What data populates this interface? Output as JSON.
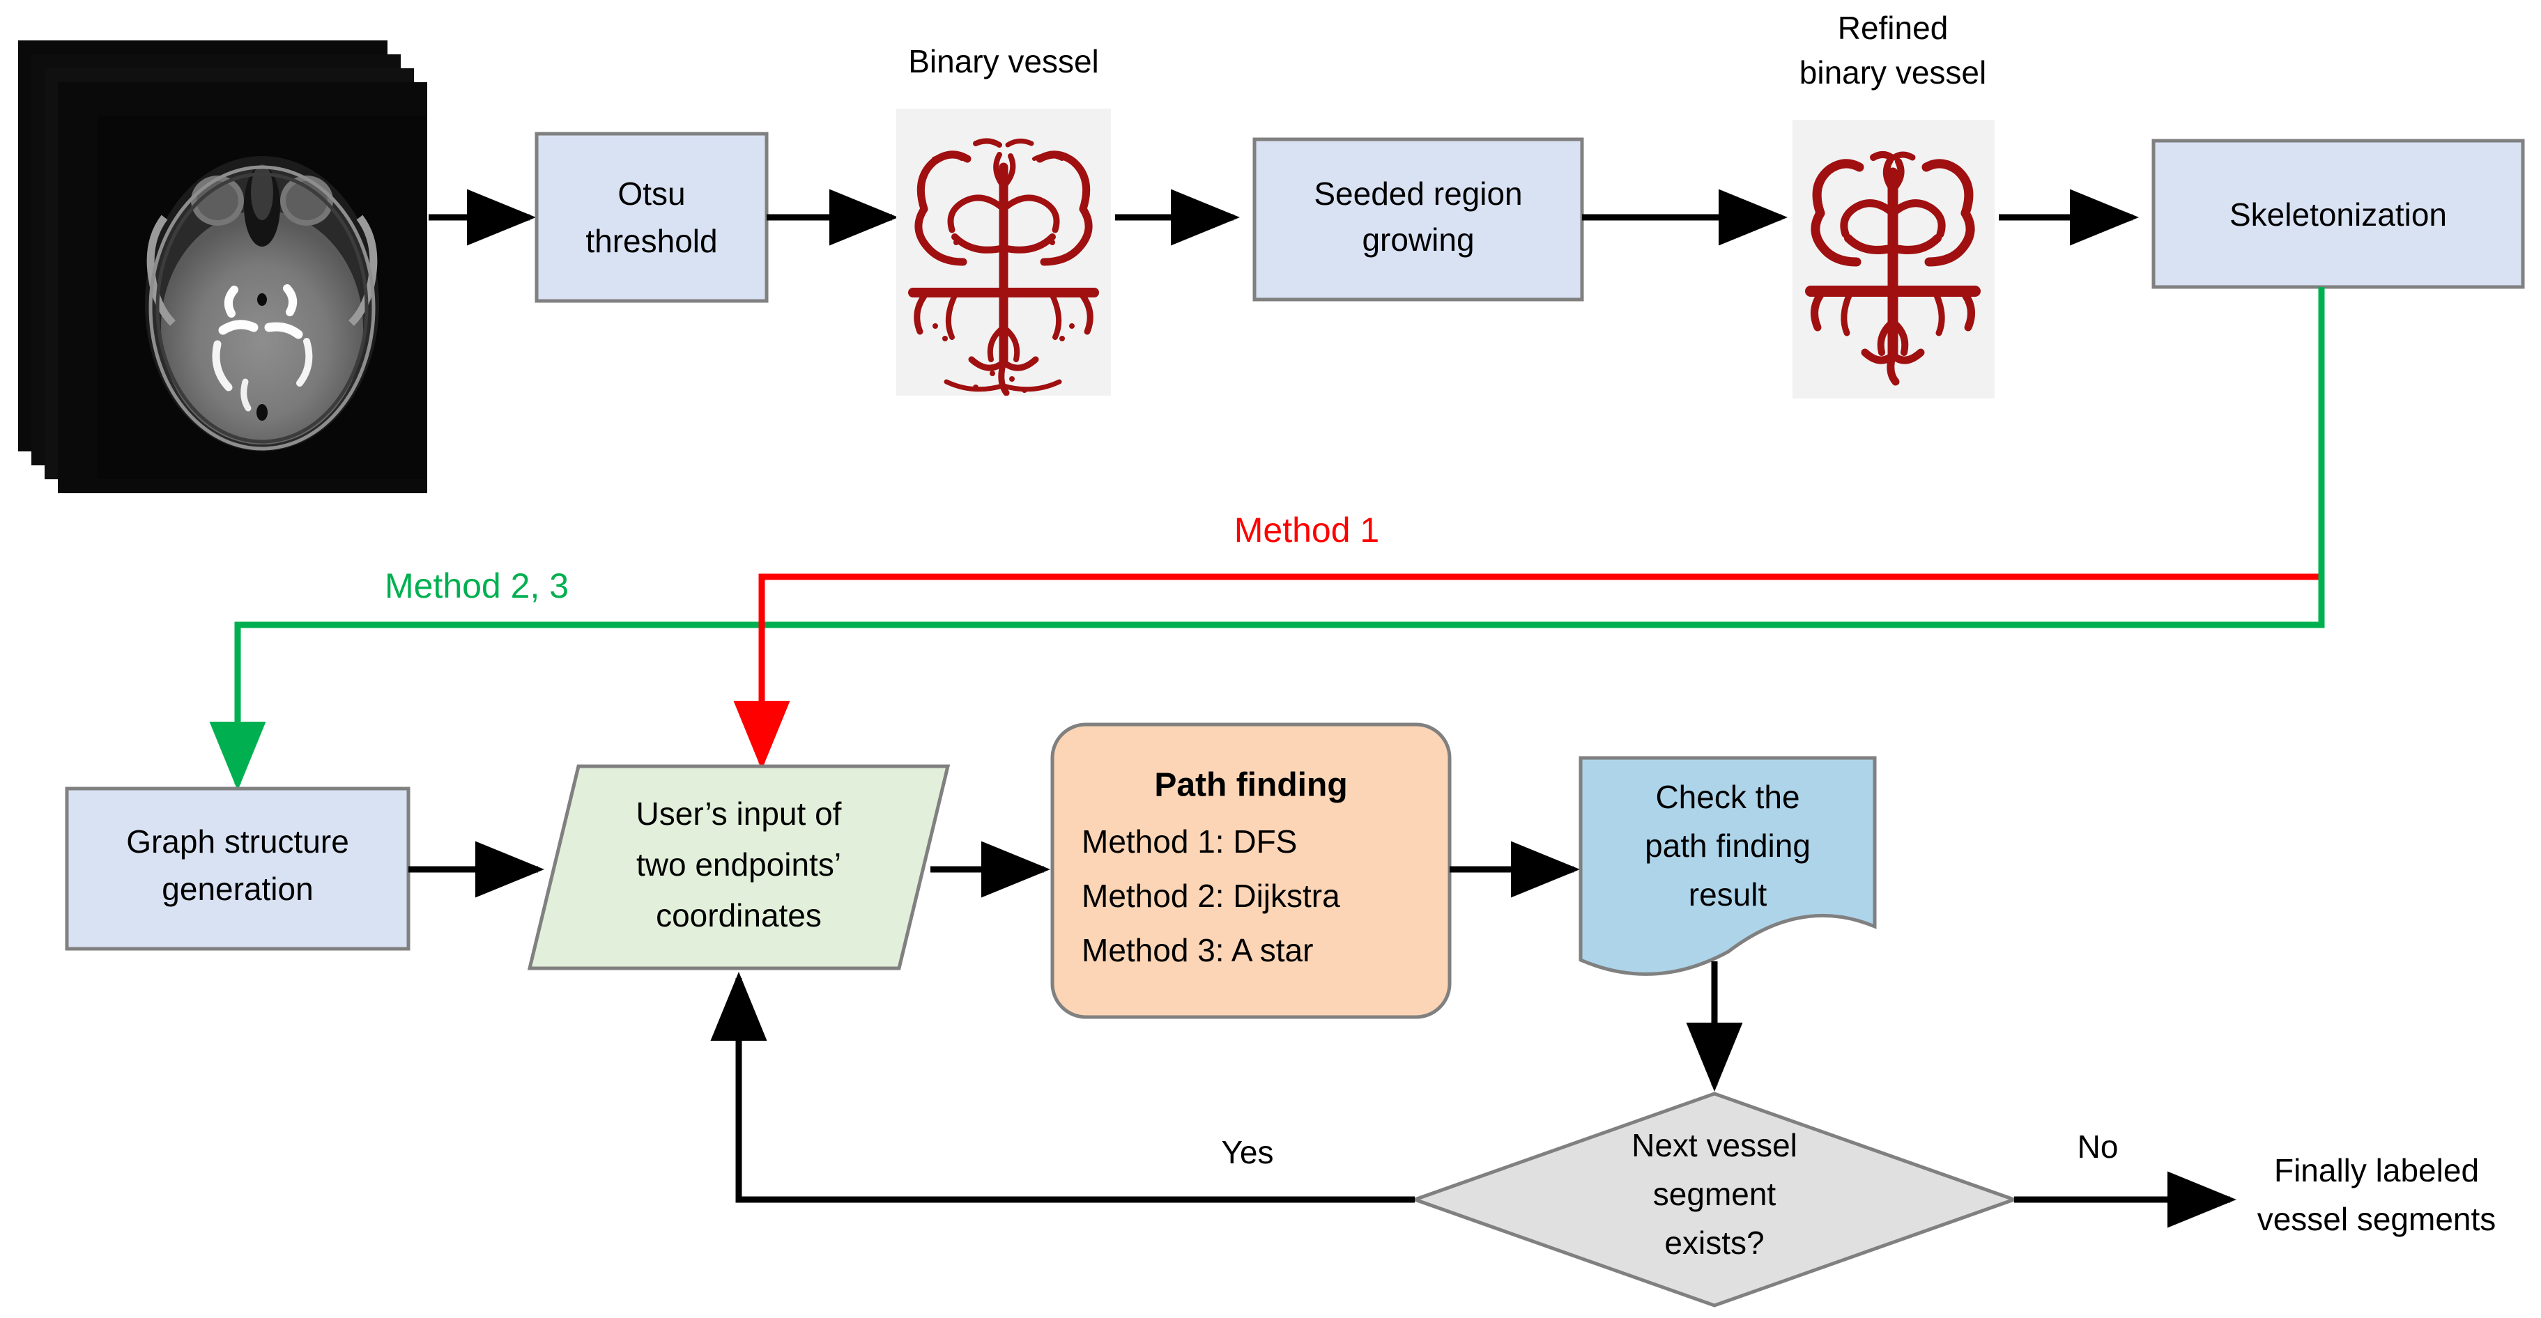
{
  "diagram": {
    "title": "Vessel segmentation and labeling pipeline flowchart",
    "colors": {
      "process_fill": "#d9e2f3",
      "document_fill": "#aed4ea",
      "io_fill": "#e2efda",
      "pathfinding_fill": "#fbd5b5",
      "decision_fill": "#e0e0e0",
      "border": "#808080",
      "method1_red": "#ff0000",
      "method23_green": "#00b050",
      "vessel_red": "#a01010",
      "image_bg": "#f2f2f2"
    },
    "captions": {
      "binary_vessel": "Binary vessel",
      "refined_binary_vessel_line1": "Refined",
      "refined_binary_vessel_line2": "binary vessel"
    },
    "nodes": {
      "mri_stack": {
        "name": "MRI slice stack"
      },
      "otsu": {
        "line1": "Otsu",
        "line2": "threshold"
      },
      "binary_vessel_image": {
        "name": "Binary vessel image"
      },
      "seeded": {
        "line1": "Seeded region",
        "line2": "growing"
      },
      "refined_vessel_image": {
        "name": "Refined binary vessel image"
      },
      "skeletonization": {
        "label": "Skeletonization"
      },
      "graph_structure": {
        "line1": "Graph structure",
        "line2": "generation"
      },
      "user_input": {
        "line1": "User’s input of",
        "line2": "two endpoints’",
        "line3": "coordinates"
      },
      "path_finding": {
        "title": "Path finding",
        "methods": [
          "Method 1: DFS",
          "Method 2: Dijkstra",
          "Method 3: A star"
        ]
      },
      "check_result": {
        "line1": "Check the",
        "line2": "path finding",
        "line3": "result"
      },
      "decision": {
        "line1": "Next vessel",
        "line2": "segment",
        "line3": "exists?"
      },
      "final_output": {
        "line1": "Finally labeled",
        "line2": "vessel segments"
      }
    },
    "edge_labels": {
      "method1": "Method  1",
      "method23": "Method 2, 3",
      "yes": "Yes",
      "no": "No"
    }
  }
}
